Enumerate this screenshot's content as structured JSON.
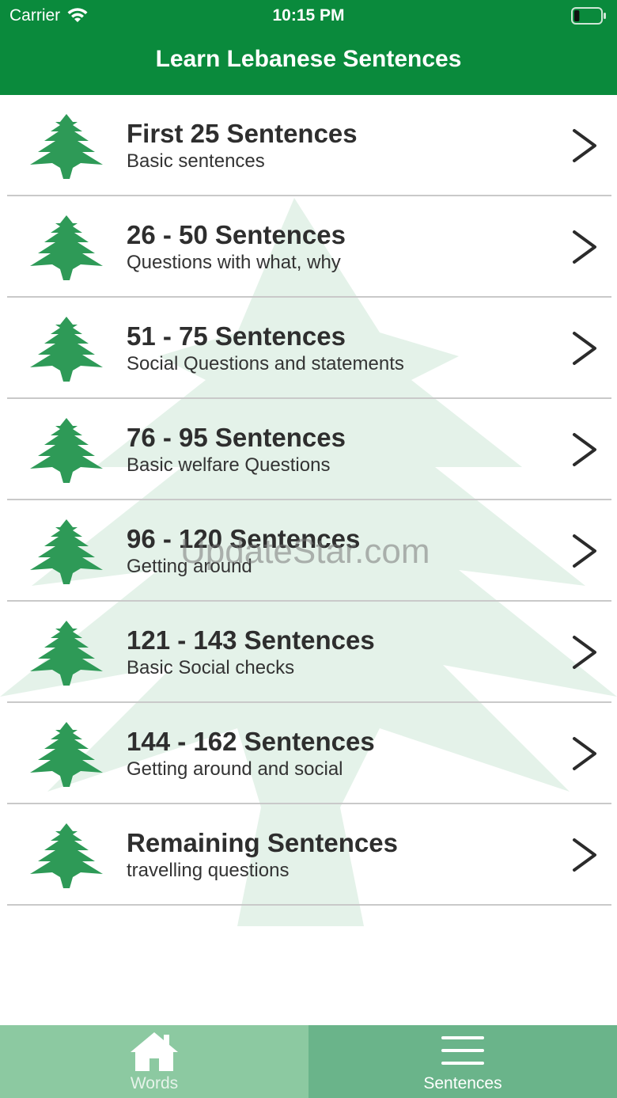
{
  "status_bar": {
    "carrier": "Carrier",
    "time": "10:15 PM",
    "battery_level": 0.2
  },
  "header": {
    "title": "Learn Lebanese Sentences"
  },
  "colors": {
    "primary_green": "#0a8a3c",
    "cedar_green": "#2e9a57",
    "tab_inactive": "#8cc9a1",
    "tab_active": "#6ab48a"
  },
  "list": {
    "items": [
      {
        "title": "First 25 Sentences",
        "subtitle": "Basic sentences",
        "icon": "cedar-icon"
      },
      {
        "title": "26 - 50 Sentences",
        "subtitle": "Questions with what, why",
        "icon": "cedar-icon"
      },
      {
        "title": "51 - 75 Sentences",
        "subtitle": "Social Questions and statements",
        "icon": "cedar-icon"
      },
      {
        "title": "76 - 95 Sentences",
        "subtitle": "Basic welfare Questions",
        "icon": "cedar-icon"
      },
      {
        "title": "96 - 120 Sentences",
        "subtitle": "Getting around",
        "icon": "cedar-icon"
      },
      {
        "title": "121 - 143 Sentences",
        "subtitle": "Basic Social checks",
        "icon": "cedar-icon"
      },
      {
        "title": "144 - 162 Sentences",
        "subtitle": "Getting around and social",
        "icon": "cedar-icon"
      },
      {
        "title": "Remaining Sentences",
        "subtitle": "travelling questions",
        "icon": "cedar-icon"
      }
    ]
  },
  "watermark": "UpdateStar.com",
  "tabbar": {
    "tabs": [
      {
        "label": "Words",
        "icon": "home-icon",
        "selected": false
      },
      {
        "label": "Sentences",
        "icon": "menu-icon",
        "selected": true
      }
    ]
  }
}
